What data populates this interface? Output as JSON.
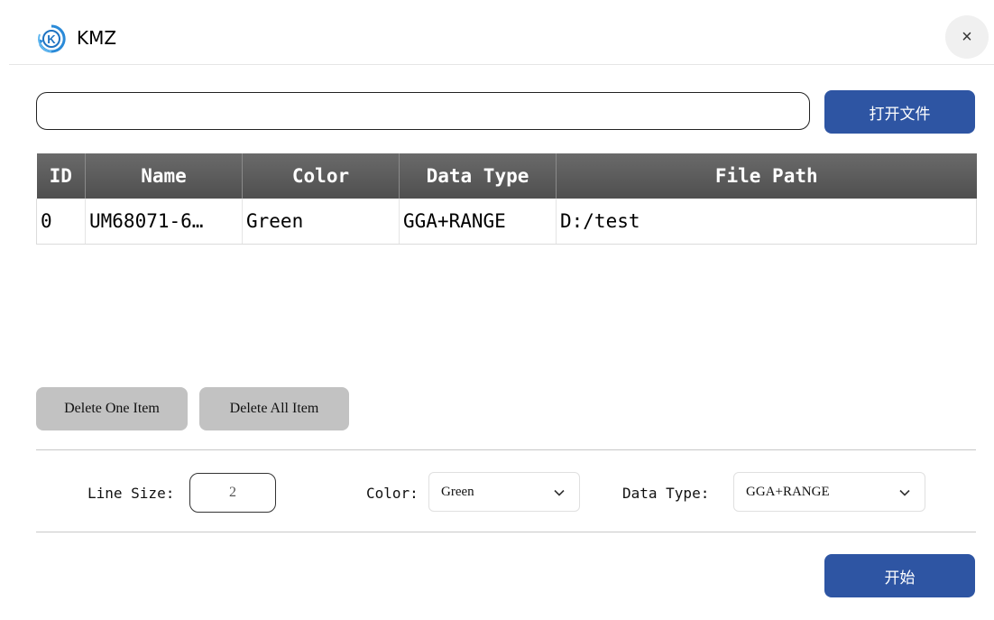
{
  "window": {
    "title": "KMZ",
    "close_label": "×",
    "logo_letter": "K"
  },
  "file_bar": {
    "path_value": "",
    "open_button_label": "打开文件"
  },
  "table": {
    "columns": [
      "ID",
      "Name",
      "Color",
      "Data Type",
      "File Path"
    ],
    "rows": [
      {
        "id": "0",
        "name": "UM68071-6…",
        "color": "Green",
        "data_type": "GGA+RANGE",
        "file_path": "D:/test"
      }
    ]
  },
  "actions": {
    "delete_one_label": "Delete One Item",
    "delete_all_label": "Delete All Item"
  },
  "settings": {
    "line_size_label": "Line Size:",
    "line_size_value": "2",
    "color_label": "Color:",
    "color_value": "Green",
    "data_type_label": "Data Type:",
    "data_type_value": "GGA+RANGE"
  },
  "footer": {
    "start_button_label": "开始"
  },
  "colors": {
    "primary": "#2e55a3",
    "header_bg": "#5c5c5c",
    "gray_button": "#c2c2c2",
    "logo_blue": "#2a8ad8"
  }
}
